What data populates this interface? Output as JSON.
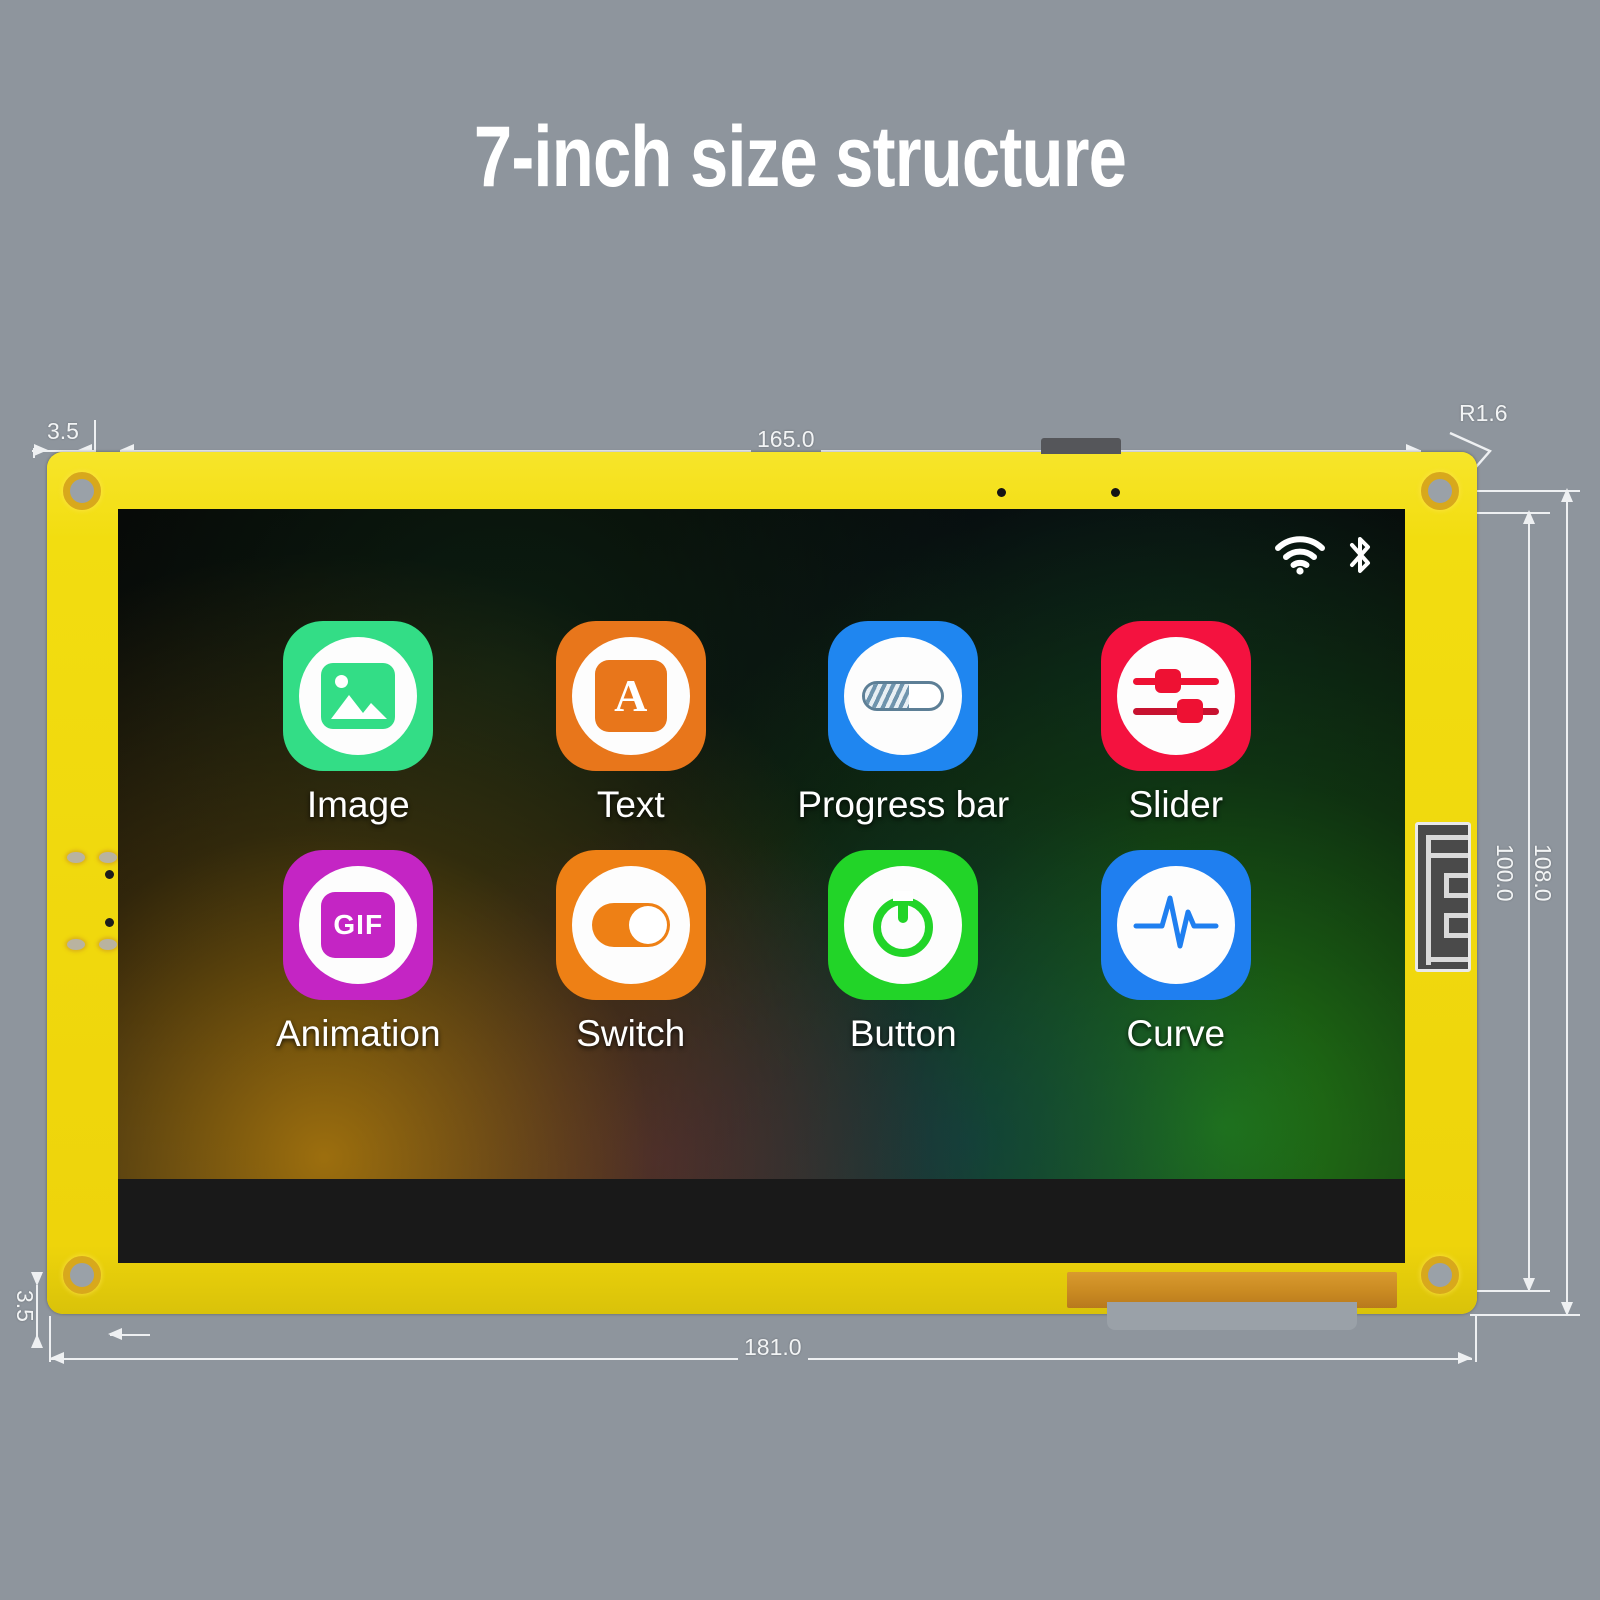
{
  "page": {
    "title": "7-inch size structure",
    "background_color": "#8e959d",
    "title_color": "#ffffff"
  },
  "board": {
    "pcb_color": "#f2dd10",
    "screen_bezel_color": "#0a0a0a",
    "antenna_label": "pcb-antenna"
  },
  "dimensions": {
    "top_left_margin": "3.5",
    "bottom_left_margin": "3.5",
    "corner_radius": "R1.6",
    "display_width": "165.0",
    "board_width": "181.0",
    "board_height": "108.0",
    "display_height": "100.0"
  },
  "screen": {
    "status_icons": [
      "wifi-icon",
      "bluetooth-icon"
    ],
    "apps": [
      {
        "label": "Image",
        "tile_color": "#33dd86",
        "accent": "#33dd86",
        "icon": "image-icon"
      },
      {
        "label": "Text",
        "tile_color": "#e8761b",
        "accent": "#e8761b",
        "icon": "text-a-icon"
      },
      {
        "label": "Progress bar",
        "tile_color": "#1f86f0",
        "accent": "#5d7f96",
        "icon": "progress-bar-icon"
      },
      {
        "label": "Slider",
        "tile_color": "#f4123f",
        "accent": "#ee1133",
        "icon": "slider-icon"
      },
      {
        "label": "Animation",
        "tile_color": "#c425c4",
        "accent": "#c425c4",
        "icon": "gif-icon"
      },
      {
        "label": "Switch",
        "tile_color": "#ee8015",
        "accent": "#ee8015",
        "icon": "toggle-switch-icon"
      },
      {
        "label": "Button",
        "tile_color": "#22d428",
        "accent": "#22d428",
        "icon": "power-button-icon"
      },
      {
        "label": "Curve",
        "tile_color": "#1f7ff0",
        "accent": "#1f7ff0",
        "icon": "waveform-icon"
      }
    ],
    "gif_badge_text": "GIF",
    "text_badge_letter": "A"
  }
}
